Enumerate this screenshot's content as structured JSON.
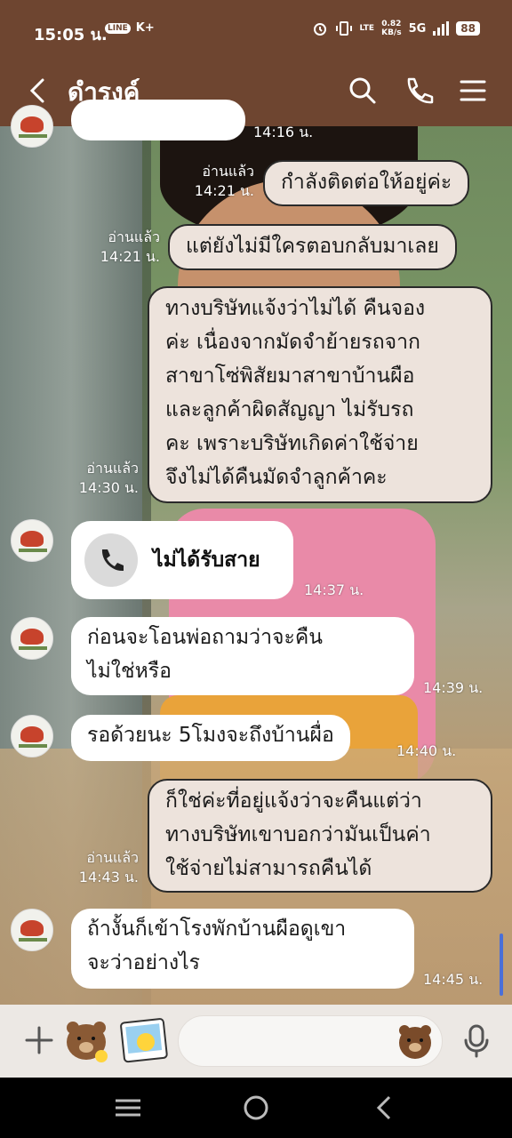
{
  "status_bar": {
    "time": "15:05 น.",
    "app_badge": "LINE",
    "app_extra": "K+",
    "net_speed_top": "0.82",
    "net_speed_bottom": "KB/s",
    "network": "5G",
    "volte": "LTE",
    "battery": "88"
  },
  "header": {
    "title": "ดำรงค์",
    "back_icon": "chevron-left-icon",
    "search_icon": "search-icon",
    "call_icon": "phone-icon",
    "menu_icon": "menu-icon"
  },
  "messages": [
    {
      "id": "m0",
      "direction": "in",
      "text_lines": [
        "..."
      ],
      "time": "14:16 น."
    },
    {
      "id": "m1",
      "direction": "out",
      "read": "อ่านแล้ว",
      "time": "14:21 น.",
      "text_lines": [
        "กำลังติดต่อให้อยู่ค่ะ"
      ]
    },
    {
      "id": "m2",
      "direction": "out",
      "read": "อ่านแล้ว",
      "time": "14:21 น.",
      "text_lines": [
        "แต่ยังไม่มีใครตอบกลับมาเลย"
      ]
    },
    {
      "id": "m3",
      "direction": "out",
      "read": "อ่านแล้ว",
      "time": "14:30 น.",
      "text_lines": [
        "ทางบริษัทแจ้งว่าไม่ได้ คืนจอง",
        "ค่ะ เนื่องจากมัดจำย้ายรถจาก",
        "สาขาโซ่พิสัยมาสาขาบ้านผือ",
        "และลูกค้าผิดสัญญา ไม่รับรถ",
        "คะ เพราะบริษัทเกิดค่าใช้จ่าย",
        "จึงไม่ได้คืนมัดจำลูกค้าคะ"
      ]
    },
    {
      "id": "m4",
      "direction": "in",
      "type": "missed-call",
      "label": "ไม่ได้รับสาย",
      "time": "14:37 น."
    },
    {
      "id": "m5",
      "direction": "in",
      "time": "14:39 น.",
      "text_lines": [
        "ก่อนจะโอนพ่อถามว่าจะคืน",
        "ไม่ใช่หรือ"
      ]
    },
    {
      "id": "m6",
      "direction": "in",
      "time": "14:40 น.",
      "text_lines": [
        "รอด้วยนะ  5โมงจะถึงบ้านผื่อ"
      ]
    },
    {
      "id": "m7",
      "direction": "out",
      "read": "อ่านแล้ว",
      "time": "14:43 น.",
      "text_lines": [
        "ก็ใช่ค่ะที่อยู่แจ้งว่าจะคืนแต่ว่า",
        "ทางบริษัทเขาบอกว่ามันเป็นค่า",
        "ใช้จ่ายไม่สามารถคืนได้"
      ]
    },
    {
      "id": "m8",
      "direction": "in",
      "time": "14:45 น.",
      "text_lines": [
        "ถ้างั้นก็เข้าโรงพักบ้านผือดูเขา",
        "จะว่าอย่างไร"
      ]
    }
  ],
  "input_bar": {
    "placeholder": "",
    "plus_icon": "plus-icon",
    "sticker1_icon": "bear-sticker-icon",
    "sticker2_icon": "photo-sticker-icon",
    "emoji_icon": "bear-emoji-icon",
    "mic_icon": "microphone-icon"
  },
  "nav_bar": {
    "recents_icon": "recents-icon",
    "home_icon": "home-icon",
    "back_icon": "back-triangle-icon"
  },
  "colors": {
    "header_bg": "#6e4530",
    "outgoing_bubble": "#ede3dc",
    "incoming_bubble": "#ffffff",
    "input_bar_bg": "#ece8e4"
  }
}
